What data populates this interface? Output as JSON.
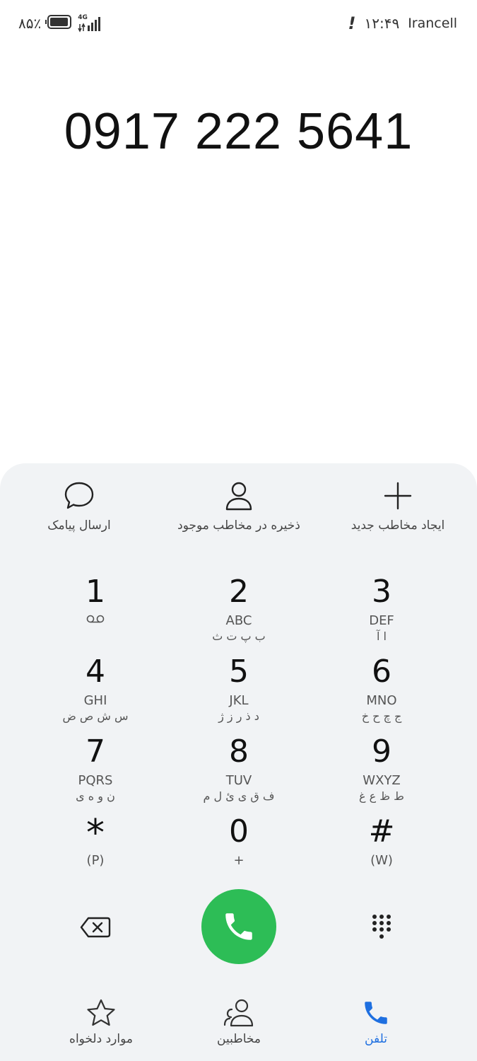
{
  "status_bar": {
    "battery_text": "۸۵٪",
    "network": "4G",
    "time": "۱۲:۴۹",
    "carrier": "Irancell"
  },
  "dialer": {
    "number": "0917 222 5641"
  },
  "actions": [
    {
      "label": "ارسال پیامک",
      "icon": "message-bubble-icon"
    },
    {
      "label": "ذخیره در مخاطب موجود",
      "icon": "person-icon"
    },
    {
      "label": "ایجاد مخاطب جدید",
      "icon": "plus-icon"
    }
  ],
  "keypad": [
    {
      "digit": "1",
      "latin": "",
      "persian": ""
    },
    {
      "digit": "2",
      "latin": "ABC",
      "persian": "ب پ ت ث"
    },
    {
      "digit": "3",
      "latin": "DEF",
      "persian": "ا آ"
    },
    {
      "digit": "4",
      "latin": "GHI",
      "persian": "س ش ص ض"
    },
    {
      "digit": "5",
      "latin": "JKL",
      "persian": "د ذ ر ز ژ"
    },
    {
      "digit": "6",
      "latin": "MNO",
      "persian": "ج چ ح خ"
    },
    {
      "digit": "7",
      "latin": "PQRS",
      "persian": "ن و ه ی"
    },
    {
      "digit": "8",
      "latin": "TUV",
      "persian": "ف ق ی ئ ل م"
    },
    {
      "digit": "9",
      "latin": "WXYZ",
      "persian": "ط ظ ع غ"
    },
    {
      "digit": "*",
      "latin": "(P)",
      "persian": ""
    },
    {
      "digit": "0",
      "latin": "+",
      "persian": ""
    },
    {
      "digit": "#",
      "latin": "(W)",
      "persian": ""
    }
  ],
  "bottom_nav": [
    {
      "label": "موارد دلخواه",
      "icon": "star-icon",
      "active": false
    },
    {
      "label": "مخاطبین",
      "icon": "contacts-icon",
      "active": false
    },
    {
      "label": "تلفن",
      "icon": "phone-icon",
      "active": true
    }
  ],
  "colors": {
    "call_green": "#2dbd56",
    "active_blue": "#1e6fe0",
    "panel_bg": "#f1f3f5"
  }
}
